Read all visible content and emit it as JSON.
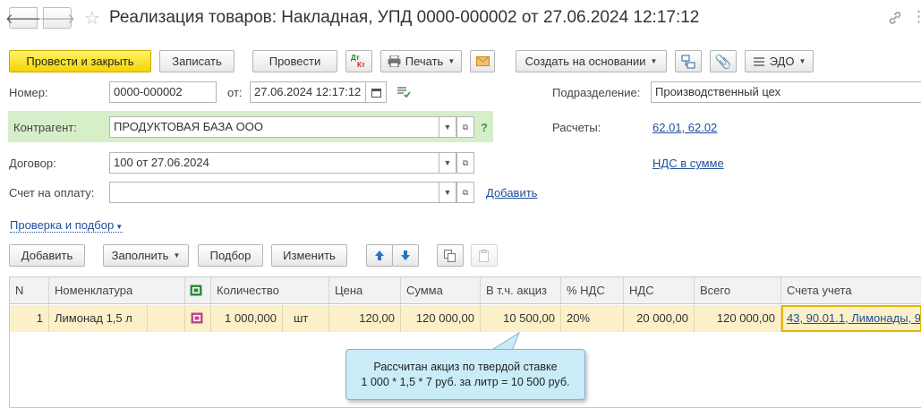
{
  "window": {
    "title": "Реализация товаров: Накладная, УПД 0000-000002 от 27.06.2024 12:17:12",
    "back_icon": "arrow-left-icon",
    "forward_icon": "arrow-right-icon",
    "favorite_icon": "star-icon",
    "link_icon": "link-icon",
    "more_icon": "more-icon"
  },
  "toolbar": {
    "post_close": "Провести и закрыть",
    "save": "Записать",
    "post": "Провести",
    "dtkt_icon_top": "Дт",
    "dtkt_icon_bottom": "Кт",
    "print": "Печать",
    "create_based": "Создать на основании",
    "edo": "ЭДО"
  },
  "form": {
    "number_label": "Номер:",
    "number_value": "0000-000002",
    "date_label": "от:",
    "date_value": "27.06.2024 12:17:12",
    "department_label": "Подразделение:",
    "department_value": "Производственный цех",
    "counterparty_label": "Контрагент:",
    "counterparty_value": "ПРОДУКТОВАЯ БАЗА ООО",
    "help": "?",
    "settlements_label": "Расчеты:",
    "settlements_value": "62.01, 62.02",
    "contract_label": "Договор:",
    "contract_value": "100 от 27.06.2024",
    "vat_link": "НДС в сумме",
    "invoice_label": "Счет на оплату:",
    "invoice_value": "",
    "add_link": "Добавить",
    "check_link": "Проверка и подбор"
  },
  "table_toolbar": {
    "add": "Добавить",
    "fill": "Заполнить",
    "select": "Подбор",
    "change": "Изменить"
  },
  "table": {
    "headers": [
      "N",
      "Номенклатура",
      "",
      "Количество",
      "Цена",
      "Сумма",
      "В т.ч. акциз",
      "% НДС",
      "НДС",
      "Всего",
      "Счета учета"
    ],
    "rows": [
      {
        "n": "1",
        "item": "Лимонад 1,5 л",
        "qty": "1 000,000",
        "unit": "шт",
        "price": "120,00",
        "sum": "120 000,00",
        "excise": "10 500,00",
        "vat_rate": "20%",
        "vat": "20 000,00",
        "total": "120 000,00",
        "accounts": "43, 90.01.1, Лимонады, 9"
      }
    ]
  },
  "tooltip": {
    "line1": "Рассчитан акциз по твердой ставке",
    "line2": "1 000 * 1,5 * 7 руб. за литр = 10 500 руб."
  },
  "colors": {
    "primary_button": "#f4d400",
    "highlight_row": "#fbf0c9",
    "counterparty_band": "#d6efc9",
    "tooltip_bg": "#c9ecf8",
    "link": "#1f4e9c"
  }
}
